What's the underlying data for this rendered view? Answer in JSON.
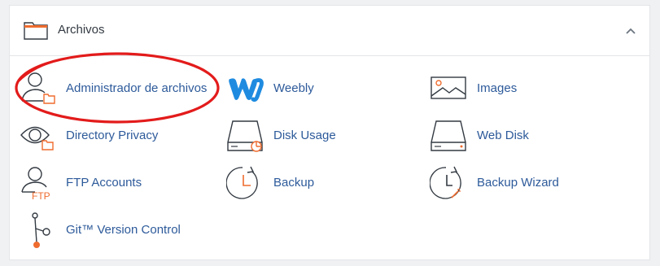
{
  "section": {
    "title": "Archivos",
    "accent_color": "#ef6c2f",
    "link_color": "#2d5a9a",
    "highlight_color": "#e31b1b"
  },
  "items": [
    {
      "label": "Administrador de archivos",
      "icon": "file-manager-icon"
    },
    {
      "label": "Weebly",
      "icon": "weebly-icon"
    },
    {
      "label": "Images",
      "icon": "images-icon"
    },
    {
      "label": "Directory Privacy",
      "icon": "directory-privacy-icon"
    },
    {
      "label": "Disk Usage",
      "icon": "disk-usage-icon"
    },
    {
      "label": "Web Disk",
      "icon": "web-disk-icon"
    },
    {
      "label": "FTP Accounts",
      "icon": "ftp-accounts-icon"
    },
    {
      "label": "Backup",
      "icon": "backup-icon"
    },
    {
      "label": "Backup Wizard",
      "icon": "backup-wizard-icon"
    },
    {
      "label": "Git™ Version Control",
      "icon": "git-version-control-icon"
    }
  ],
  "ftp_icon_text": "FTP"
}
